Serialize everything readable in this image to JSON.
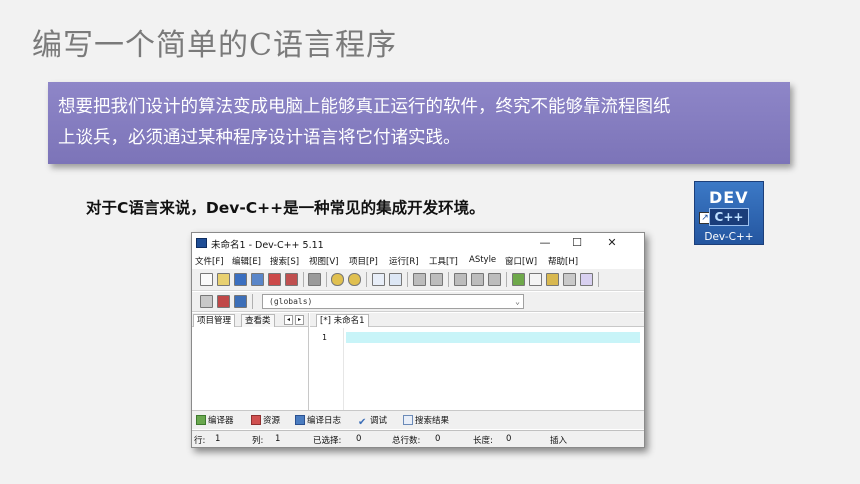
{
  "slide": {
    "title": "编写一个简单的C语言程序",
    "callout_line1": "想要把我们设计的算法变成电脑上能够真正运行的软件，终究不能够靠流程图纸",
    "callout_line2": "上谈兵，必须通过某种程序设计语言将它付诸实践。",
    "subtitle": "对于C语言来说，Dev-C++是一种常见的集成开发环境。",
    "accent_color": "#8179bf"
  },
  "logo": {
    "top_text": "DEV",
    "box_text": "C++",
    "caption": "Dev-C++"
  },
  "window": {
    "title": "未命名1 - Dev-C++ 5.11",
    "controls": {
      "minimize": "—",
      "maximize": "☐",
      "close": "✕"
    },
    "menu": [
      "文件[F]",
      "编辑[E]",
      "搜索[S]",
      "视图[V]",
      "项目[P]",
      "运行[R]",
      "工具[T]",
      "AStyle",
      "窗口[W]",
      "帮助[H]"
    ],
    "scope_combo": "(globals)",
    "left_tabs": [
      "项目管理",
      "查看类"
    ],
    "editor_tab": "[*] 未命名1",
    "line_number": "1",
    "bottom_tabs": [
      "编译器",
      "资源",
      "编译日志",
      "调试",
      "搜索结果"
    ],
    "status": {
      "row_label": "行:",
      "row_value": "1",
      "col_label": "列:",
      "col_value": "1",
      "sel_label": "已选择:",
      "sel_value": "0",
      "total_label": "总行数:",
      "total_value": "0",
      "len_label": "长度:",
      "len_value": "0",
      "mode": "插入"
    }
  }
}
